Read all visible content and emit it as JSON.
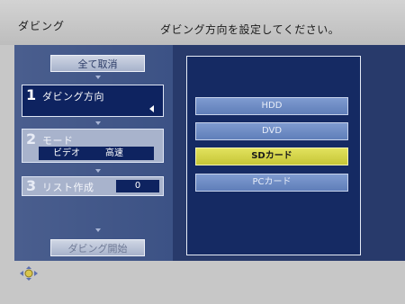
{
  "header": {
    "title": "ダビング",
    "message": "ダビング方向を設定してください。"
  },
  "buttons": {
    "cancel_all": "全て取消",
    "start_dubbing": "ダビング開始"
  },
  "steps": [
    {
      "number": "1",
      "label": "ダビング方向"
    },
    {
      "number": "2",
      "label": "モード",
      "media": "ビデオ",
      "speed": "高速"
    },
    {
      "number": "3",
      "label": "リスト作成",
      "value": "0"
    }
  ],
  "options": [
    {
      "label": "HDD"
    },
    {
      "label": "DVD"
    },
    {
      "label": "SDカード"
    },
    {
      "label": "PCカード"
    }
  ],
  "selected_option": "SDカード",
  "icons": {
    "remote_dpad": "dpad-icon",
    "direction_arrow": "triangle-left-icon"
  },
  "colors": {
    "background": "#c7c7c7",
    "panel": "#283a6b",
    "selected": "#d8d84a",
    "option": "#6f8dc5"
  }
}
